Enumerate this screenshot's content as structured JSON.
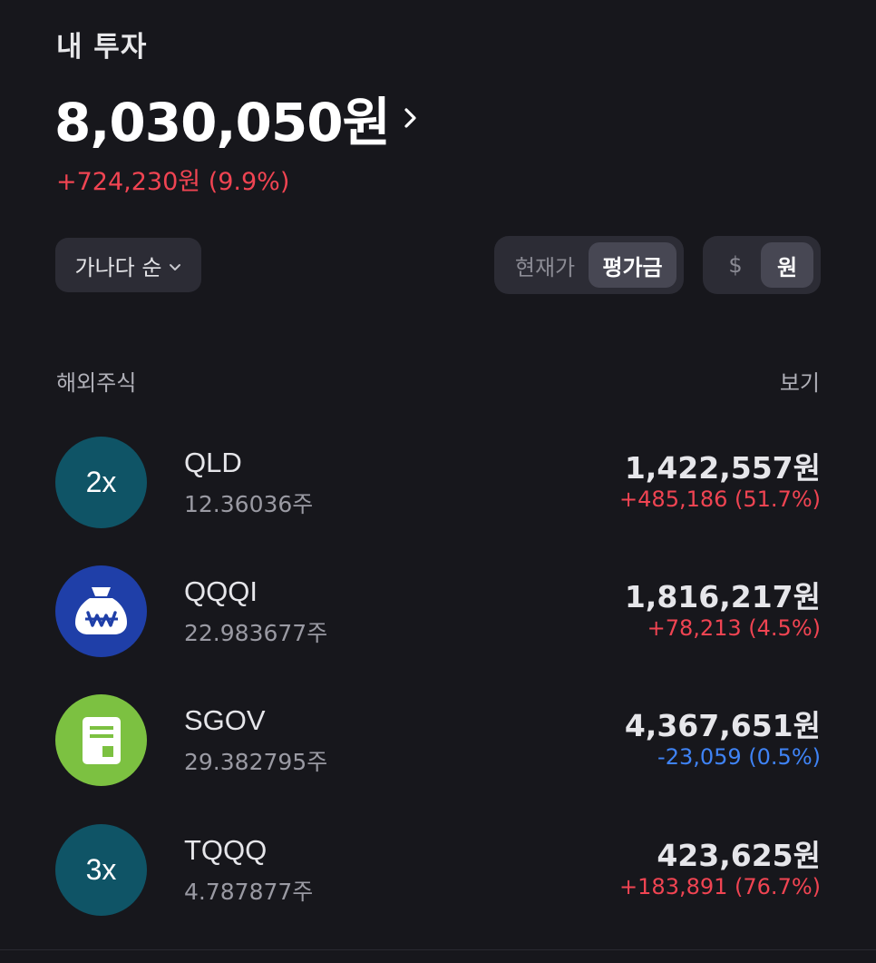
{
  "portfolio": {
    "title": "내 투자",
    "total_value": "8,030,050원",
    "total_change": "+724,230원 (9.9%)"
  },
  "controls": {
    "sort_label": "가나다 순",
    "view_toggle": [
      {
        "label": "현재가",
        "active": false
      },
      {
        "label": "평가금",
        "active": true
      }
    ],
    "currency_toggle": [
      {
        "label": "$",
        "active": false
      },
      {
        "label": "원",
        "active": true
      }
    ]
  },
  "group": {
    "label": "해외주식",
    "action": "보기"
  },
  "holdings": [
    {
      "name": "QLD",
      "quantity": "12.36036주",
      "value": "1,422,557원",
      "change": "+485,186 (51.7%)",
      "direction": "up",
      "icon": "leverage-2x-icon",
      "icon_text": "2x",
      "icon_color": "#0f5466"
    },
    {
      "name": "QQQI",
      "quantity": "22.983677주",
      "value": "1,816,217원",
      "change": "+78,213 (4.5%)",
      "direction": "up",
      "icon": "money-bag-won-icon",
      "icon_color": "#1f3fa8"
    },
    {
      "name": "SGOV",
      "quantity": "29.382795주",
      "value": "4,367,651원",
      "change": "-23,059 (0.5%)",
      "direction": "down",
      "icon": "bond-document-icon",
      "icon_color": "#7cc141"
    },
    {
      "name": "TQQQ",
      "quantity": "4.787877주",
      "value": "423,625원",
      "change": "+183,891 (76.7%)",
      "direction": "up",
      "icon": "leverage-3x-icon",
      "icon_text": "3x",
      "icon_color": "#0f5466"
    }
  ],
  "colors": {
    "background": "#17171c",
    "positive": "#f04452",
    "negative": "#3f83f5"
  }
}
